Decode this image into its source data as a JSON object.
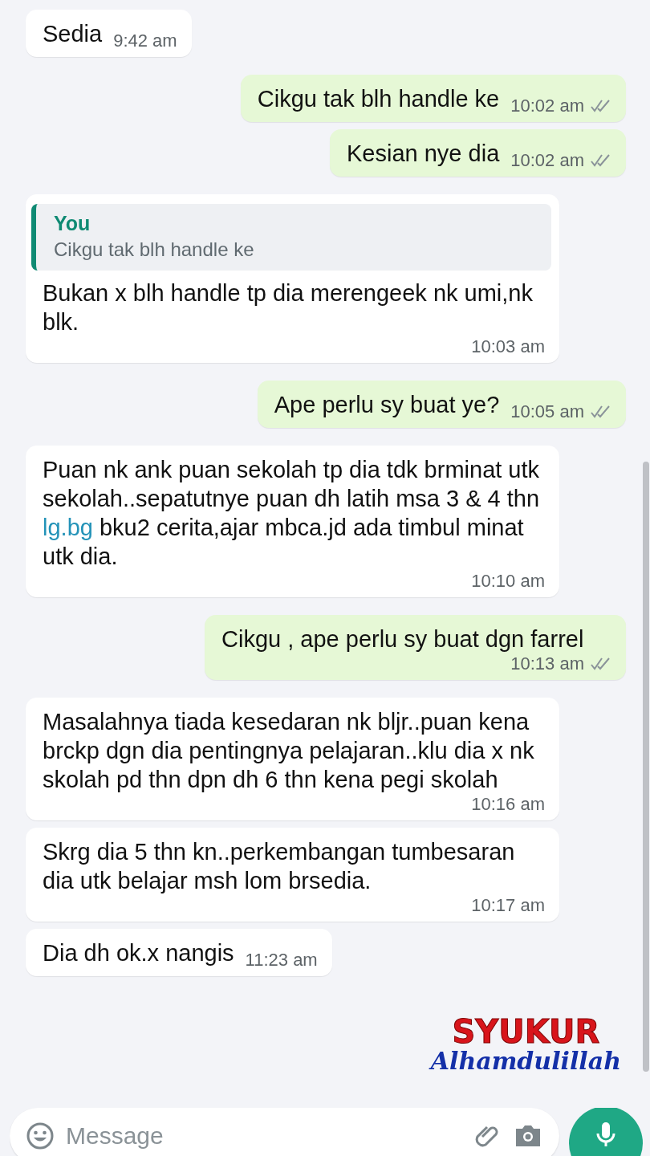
{
  "messages": [
    {
      "kind": "incoming",
      "parts": [
        {
          "kind": "text",
          "text": "Sedia"
        }
      ],
      "time": "9:42 am"
    },
    {
      "kind": "outgoing",
      "parts": [
        {
          "kind": "text",
          "text": "Cikgu tak blh handle ke"
        }
      ],
      "time": "10:02 am",
      "read": false
    },
    {
      "kind": "outgoing",
      "parts": [
        {
          "kind": "text",
          "text": "Kesian nye dia"
        }
      ],
      "time": "10:02 am",
      "read": false
    },
    {
      "kind": "incoming",
      "quote": {
        "author": "You",
        "text": "Cikgu tak blh handle ke"
      },
      "parts": [
        {
          "kind": "text",
          "text": "Bukan x blh handle tp dia merengeek nk umi,nk blk."
        }
      ],
      "time": "10:03 am"
    },
    {
      "kind": "outgoing",
      "parts": [
        {
          "kind": "text",
          "text": "Ape perlu sy buat ye?"
        }
      ],
      "time": "10:05 am",
      "read": false
    },
    {
      "kind": "incoming",
      "parts": [
        {
          "kind": "text",
          "text": "Puan nk ank puan sekolah tp dia tdk brminat utk sekolah..sepatutnye puan dh latih msa 3 & 4 thn "
        },
        {
          "kind": "link",
          "text": "lg.bg"
        },
        {
          "kind": "text",
          "text": " bku2 cerita,ajar mbca.jd ada timbul minat utk dia."
        }
      ],
      "time": "10:10 am"
    },
    {
      "kind": "outgoing",
      "parts": [
        {
          "kind": "text",
          "text": "Cikgu , ape perlu sy buat dgn farrel"
        }
      ],
      "time": "10:13 am",
      "read": false
    },
    {
      "kind": "incoming",
      "parts": [
        {
          "kind": "text",
          "text": "Masalahnya tiada kesedaran nk bljr..puan kena brckp dgn dia pentingnya pelajaran..klu dia x nk skolah pd thn dpn dh 6 thn kena pegi skolah"
        }
      ],
      "time": "10:16 am"
    },
    {
      "kind": "incoming",
      "parts": [
        {
          "kind": "text",
          "text": "Skrg dia 5 thn kn..perkembangan tumbesaran dia utk belajar msh lom brsedia."
        }
      ],
      "time": "10:17 am"
    },
    {
      "kind": "incoming",
      "parts": [
        {
          "kind": "text",
          "text": "Dia dh ok.x nangis"
        }
      ],
      "time": "11:23 am"
    }
  ],
  "sticker": {
    "lines": [
      "SYUKUR",
      "Alhamdulillah"
    ]
  },
  "composer": {
    "placeholder": "Message"
  }
}
